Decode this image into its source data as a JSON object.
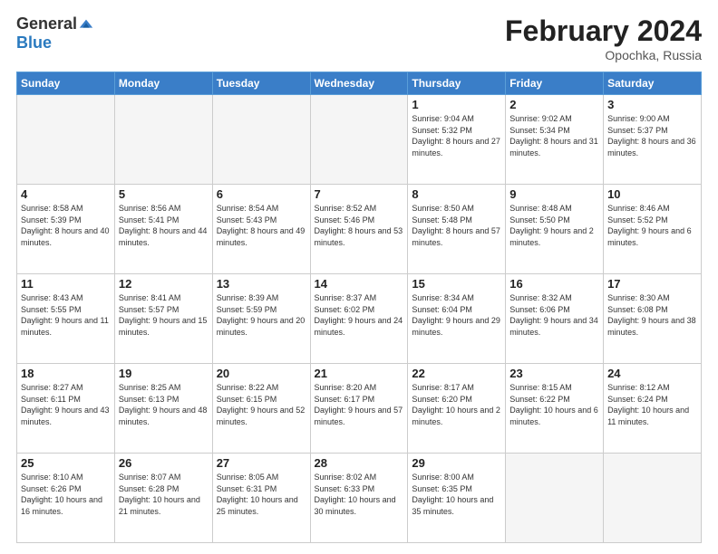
{
  "header": {
    "logo_general": "General",
    "logo_blue": "Blue",
    "title": "February 2024",
    "subtitle": "Opochka, Russia"
  },
  "weekdays": [
    "Sunday",
    "Monday",
    "Tuesday",
    "Wednesday",
    "Thursday",
    "Friday",
    "Saturday"
  ],
  "weeks": [
    [
      {
        "day": "",
        "info": "",
        "empty": true
      },
      {
        "day": "",
        "info": "",
        "empty": true
      },
      {
        "day": "",
        "info": "",
        "empty": true
      },
      {
        "day": "",
        "info": "",
        "empty": true
      },
      {
        "day": "1",
        "info": "Sunrise: 9:04 AM\nSunset: 5:32 PM\nDaylight: 8 hours\nand 27 minutes.",
        "empty": false
      },
      {
        "day": "2",
        "info": "Sunrise: 9:02 AM\nSunset: 5:34 PM\nDaylight: 8 hours\nand 31 minutes.",
        "empty": false
      },
      {
        "day": "3",
        "info": "Sunrise: 9:00 AM\nSunset: 5:37 PM\nDaylight: 8 hours\nand 36 minutes.",
        "empty": false
      }
    ],
    [
      {
        "day": "4",
        "info": "Sunrise: 8:58 AM\nSunset: 5:39 PM\nDaylight: 8 hours\nand 40 minutes.",
        "empty": false
      },
      {
        "day": "5",
        "info": "Sunrise: 8:56 AM\nSunset: 5:41 PM\nDaylight: 8 hours\nand 44 minutes.",
        "empty": false
      },
      {
        "day": "6",
        "info": "Sunrise: 8:54 AM\nSunset: 5:43 PM\nDaylight: 8 hours\nand 49 minutes.",
        "empty": false
      },
      {
        "day": "7",
        "info": "Sunrise: 8:52 AM\nSunset: 5:46 PM\nDaylight: 8 hours\nand 53 minutes.",
        "empty": false
      },
      {
        "day": "8",
        "info": "Sunrise: 8:50 AM\nSunset: 5:48 PM\nDaylight: 8 hours\nand 57 minutes.",
        "empty": false
      },
      {
        "day": "9",
        "info": "Sunrise: 8:48 AM\nSunset: 5:50 PM\nDaylight: 9 hours\nand 2 minutes.",
        "empty": false
      },
      {
        "day": "10",
        "info": "Sunrise: 8:46 AM\nSunset: 5:52 PM\nDaylight: 9 hours\nand 6 minutes.",
        "empty": false
      }
    ],
    [
      {
        "day": "11",
        "info": "Sunrise: 8:43 AM\nSunset: 5:55 PM\nDaylight: 9 hours\nand 11 minutes.",
        "empty": false
      },
      {
        "day": "12",
        "info": "Sunrise: 8:41 AM\nSunset: 5:57 PM\nDaylight: 9 hours\nand 15 minutes.",
        "empty": false
      },
      {
        "day": "13",
        "info": "Sunrise: 8:39 AM\nSunset: 5:59 PM\nDaylight: 9 hours\nand 20 minutes.",
        "empty": false
      },
      {
        "day": "14",
        "info": "Sunrise: 8:37 AM\nSunset: 6:02 PM\nDaylight: 9 hours\nand 24 minutes.",
        "empty": false
      },
      {
        "day": "15",
        "info": "Sunrise: 8:34 AM\nSunset: 6:04 PM\nDaylight: 9 hours\nand 29 minutes.",
        "empty": false
      },
      {
        "day": "16",
        "info": "Sunrise: 8:32 AM\nSunset: 6:06 PM\nDaylight: 9 hours\nand 34 minutes.",
        "empty": false
      },
      {
        "day": "17",
        "info": "Sunrise: 8:30 AM\nSunset: 6:08 PM\nDaylight: 9 hours\nand 38 minutes.",
        "empty": false
      }
    ],
    [
      {
        "day": "18",
        "info": "Sunrise: 8:27 AM\nSunset: 6:11 PM\nDaylight: 9 hours\nand 43 minutes.",
        "empty": false
      },
      {
        "day": "19",
        "info": "Sunrise: 8:25 AM\nSunset: 6:13 PM\nDaylight: 9 hours\nand 48 minutes.",
        "empty": false
      },
      {
        "day": "20",
        "info": "Sunrise: 8:22 AM\nSunset: 6:15 PM\nDaylight: 9 hours\nand 52 minutes.",
        "empty": false
      },
      {
        "day": "21",
        "info": "Sunrise: 8:20 AM\nSunset: 6:17 PM\nDaylight: 9 hours\nand 57 minutes.",
        "empty": false
      },
      {
        "day": "22",
        "info": "Sunrise: 8:17 AM\nSunset: 6:20 PM\nDaylight: 10 hours\nand 2 minutes.",
        "empty": false
      },
      {
        "day": "23",
        "info": "Sunrise: 8:15 AM\nSunset: 6:22 PM\nDaylight: 10 hours\nand 6 minutes.",
        "empty": false
      },
      {
        "day": "24",
        "info": "Sunrise: 8:12 AM\nSunset: 6:24 PM\nDaylight: 10 hours\nand 11 minutes.",
        "empty": false
      }
    ],
    [
      {
        "day": "25",
        "info": "Sunrise: 8:10 AM\nSunset: 6:26 PM\nDaylight: 10 hours\nand 16 minutes.",
        "empty": false
      },
      {
        "day": "26",
        "info": "Sunrise: 8:07 AM\nSunset: 6:28 PM\nDaylight: 10 hours\nand 21 minutes.",
        "empty": false
      },
      {
        "day": "27",
        "info": "Sunrise: 8:05 AM\nSunset: 6:31 PM\nDaylight: 10 hours\nand 25 minutes.",
        "empty": false
      },
      {
        "day": "28",
        "info": "Sunrise: 8:02 AM\nSunset: 6:33 PM\nDaylight: 10 hours\nand 30 minutes.",
        "empty": false
      },
      {
        "day": "29",
        "info": "Sunrise: 8:00 AM\nSunset: 6:35 PM\nDaylight: 10 hours\nand 35 minutes.",
        "empty": false
      },
      {
        "day": "",
        "info": "",
        "empty": true
      },
      {
        "day": "",
        "info": "",
        "empty": true
      }
    ]
  ]
}
